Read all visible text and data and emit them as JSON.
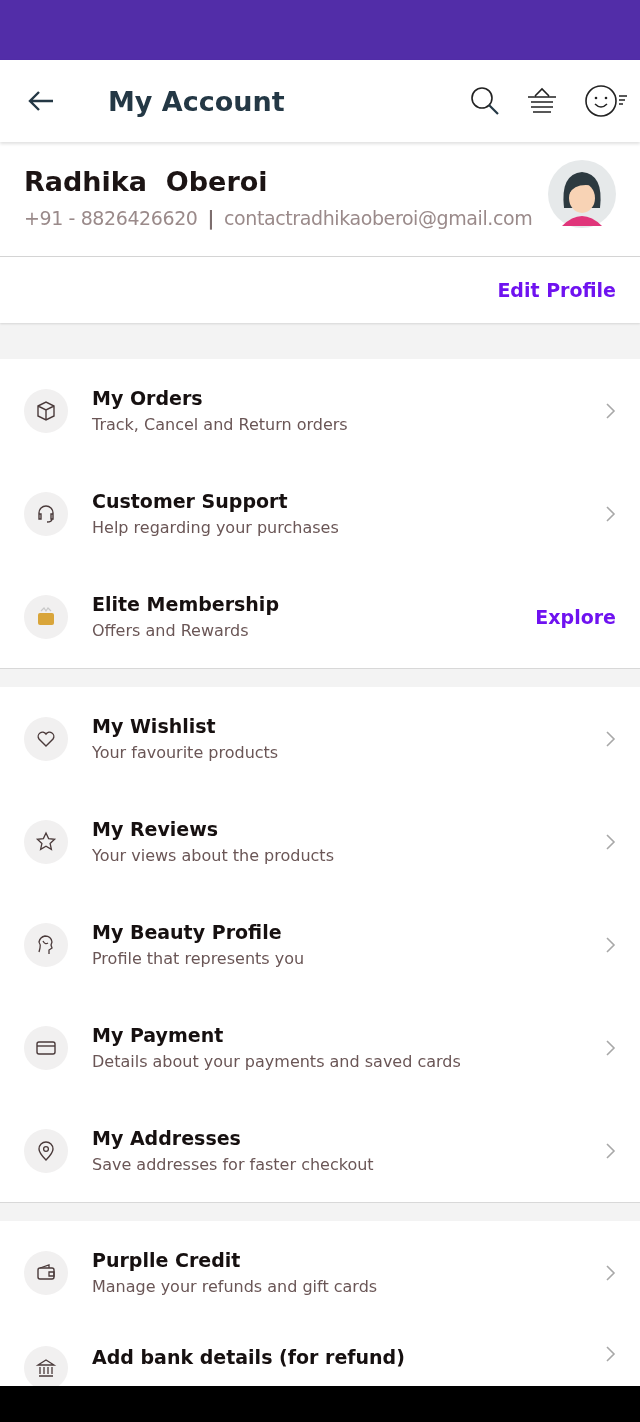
{
  "header": {
    "title": "My Account"
  },
  "profile": {
    "name": "Radhika  Oberoi",
    "phone": "+91 - 8826426620",
    "separator": "|",
    "email": "contactradhikaoberoi@gmail.com",
    "edit_link": "Edit Profile"
  },
  "sections": [
    {
      "items": [
        {
          "title": "My Orders",
          "subtitle": "Track, Cancel and Return orders",
          "kind": "chevron"
        },
        {
          "title": "Customer Support",
          "subtitle": "Help regarding your purchases",
          "kind": "chevron"
        },
        {
          "title": "Elite Membership",
          "subtitle": "Offers and Rewards",
          "kind": "link",
          "action": "Explore"
        }
      ]
    },
    {
      "items": [
        {
          "title": "My Wishlist",
          "subtitle": "Your favourite products",
          "kind": "chevron"
        },
        {
          "title": "My Reviews",
          "subtitle": "Your views about the products",
          "kind": "chevron"
        },
        {
          "title": "My Beauty Profile",
          "subtitle": "Profile that represents you",
          "kind": "chevron"
        },
        {
          "title": "My Payment",
          "subtitle": "Details about your payments and saved cards",
          "kind": "chevron"
        },
        {
          "title": "My Addresses",
          "subtitle": "Save addresses for faster checkout",
          "kind": "chevron"
        }
      ]
    },
    {
      "items": [
        {
          "title": "Purplle Credit",
          "subtitle": "Manage your refunds and gift cards",
          "kind": "chevron"
        },
        {
          "title": "Add bank details (for refund)",
          "kind": "chevron"
        }
      ]
    }
  ]
}
